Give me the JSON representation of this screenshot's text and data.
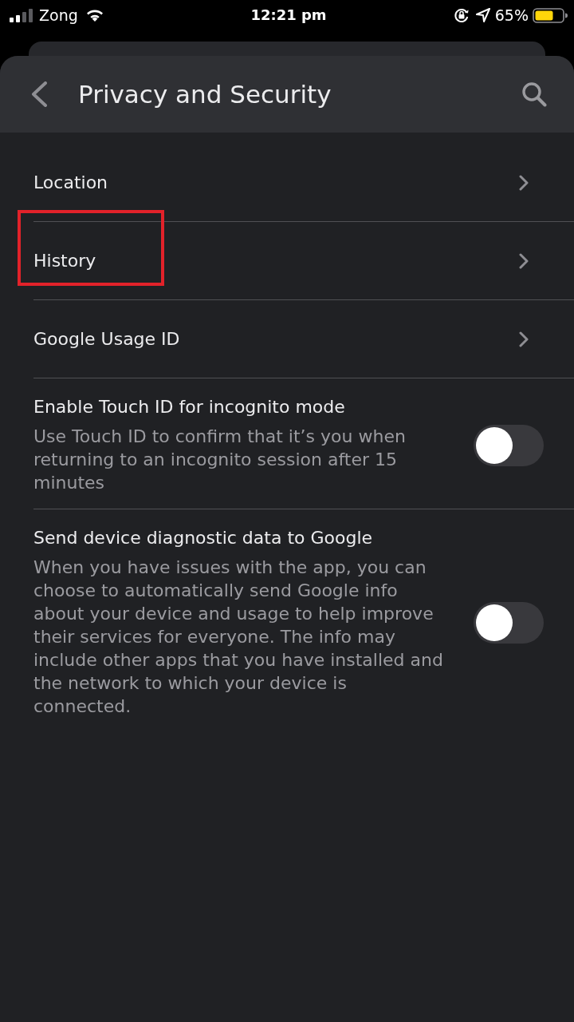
{
  "status_bar": {
    "carrier": "Zong",
    "time": "12:21 pm",
    "battery": "65%"
  },
  "header": {
    "title": "Privacy and Security"
  },
  "items": [
    {
      "kind": "link",
      "label": "Location",
      "highlighted": false
    },
    {
      "kind": "link",
      "label": "History",
      "highlighted": true
    },
    {
      "kind": "link",
      "label": "Google Usage ID",
      "highlighted": false
    },
    {
      "kind": "toggle",
      "label": "Enable Touch ID for incognito mode",
      "description": "Use Touch ID to confirm that it’s you when returning to an incognito session after 15 minutes",
      "on": false,
      "highlighted": false
    },
    {
      "kind": "toggle",
      "label": "Send device diagnostic data to Google",
      "description": "When you have issues with the app, you can choose to automatically send Google info about your device and usage to help improve their services for everyone. The info may include other apps that you have installed and the network to which your device is connected.",
      "on": false,
      "highlighted": false
    }
  ]
}
